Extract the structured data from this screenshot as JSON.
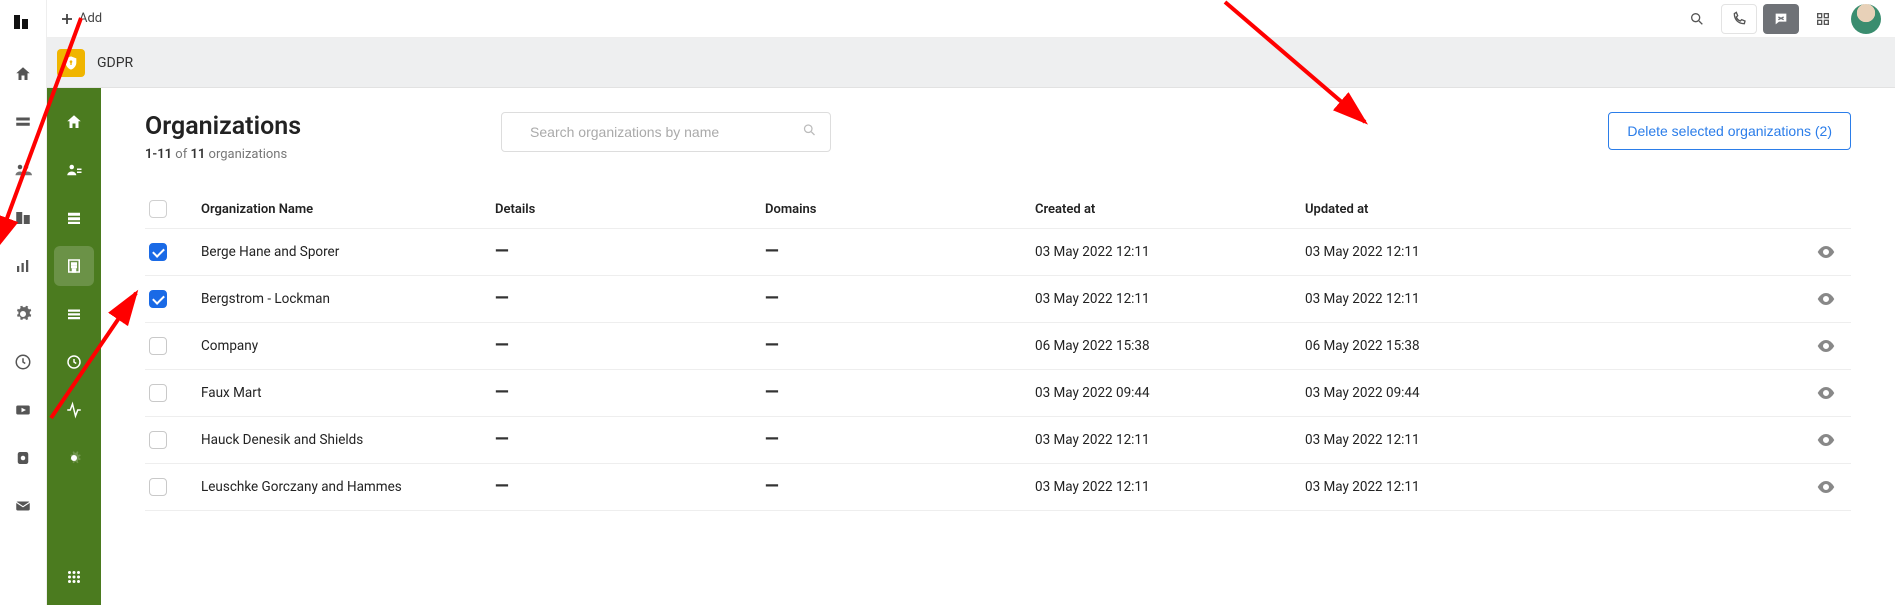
{
  "topbar": {
    "add_label": "Add"
  },
  "header": {
    "title": "GDPR"
  },
  "page": {
    "title": "Organizations",
    "sub_prefix": "1-11",
    "sub_middle": " of ",
    "sub_count": "11",
    "sub_suffix": " organizations"
  },
  "search": {
    "placeholder": "Search organizations by name"
  },
  "delete_button": {
    "label": "Delete selected organizations (2)"
  },
  "columns": {
    "name": "Organization Name",
    "details": "Details",
    "domains": "Domains",
    "created": "Created at",
    "updated": "Updated at"
  },
  "rows": [
    {
      "checked": true,
      "name": "Berge Hane and Sporer",
      "details": "—",
      "domains": "—",
      "created": "03 May 2022 12:11",
      "updated": "03 May 2022 12:11"
    },
    {
      "checked": true,
      "name": "Bergstrom - Lockman",
      "details": "—",
      "domains": "—",
      "created": "03 May 2022 12:11",
      "updated": "03 May 2022 12:11"
    },
    {
      "checked": false,
      "name": "Company",
      "details": "—",
      "domains": "—",
      "created": "06 May 2022 15:38",
      "updated": "06 May 2022 15:38"
    },
    {
      "checked": false,
      "name": "Faux Mart",
      "details": "—",
      "domains": "—",
      "created": "03 May 2022 09:44",
      "updated": "03 May 2022 09:44"
    },
    {
      "checked": false,
      "name": "Hauck Denesik and Shields",
      "details": "—",
      "domains": "—",
      "created": "03 May 2022 12:11",
      "updated": "03 May 2022 12:11"
    },
    {
      "checked": false,
      "name": "Leuschke Gorczany and Hammes",
      "details": "—",
      "domains": "—",
      "created": "03 May 2022 12:11",
      "updated": "03 May 2022 12:11"
    }
  ],
  "annotations": {
    "arrows": 3
  }
}
